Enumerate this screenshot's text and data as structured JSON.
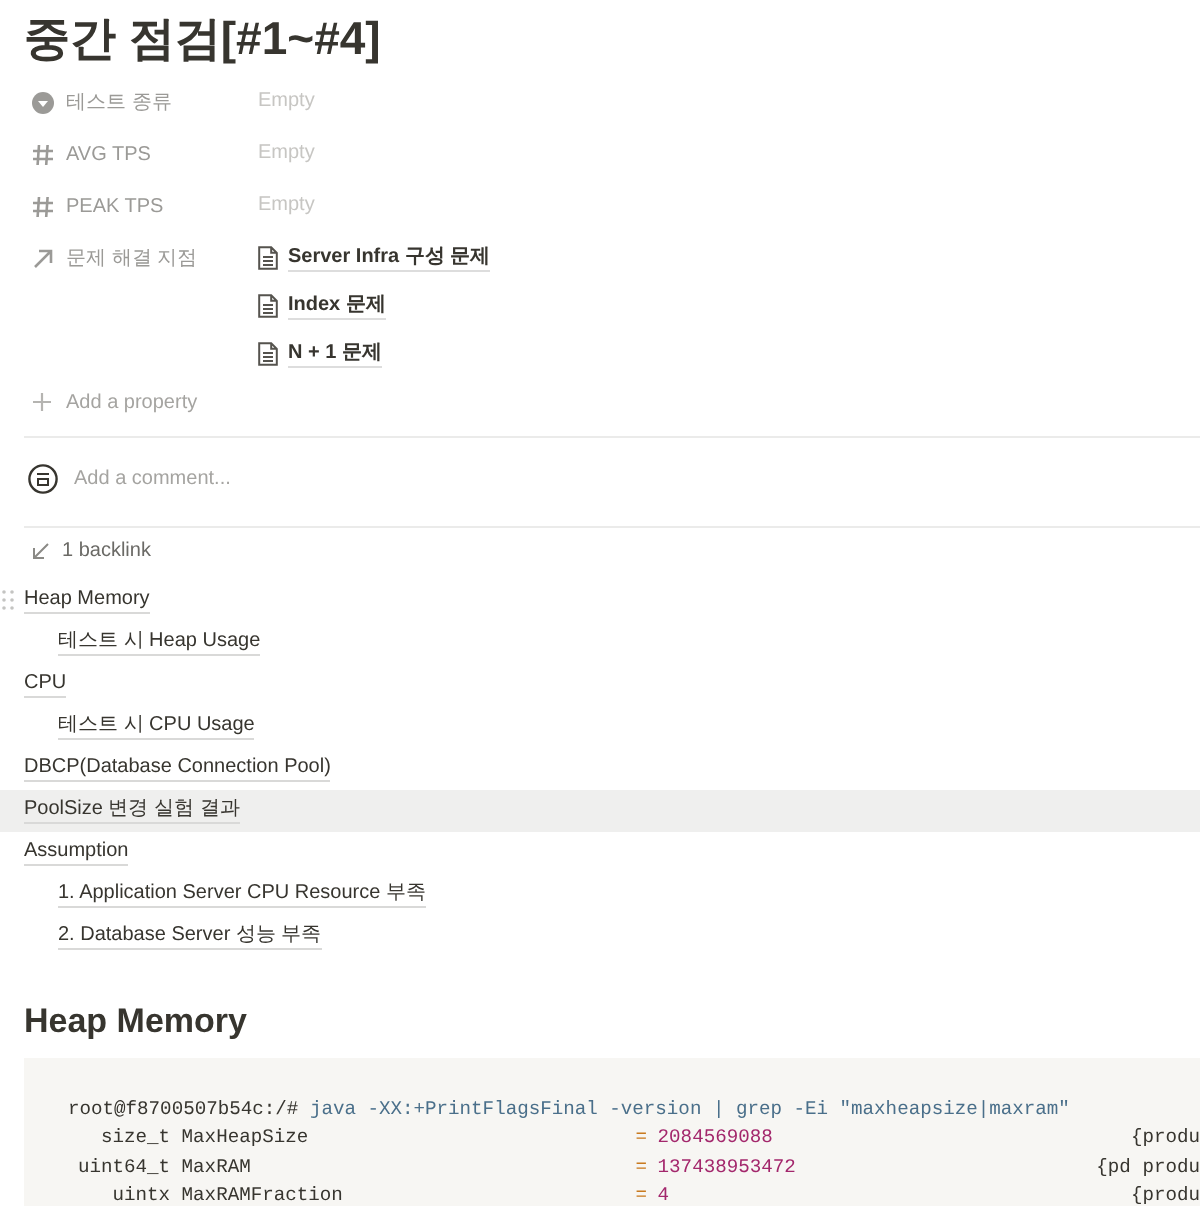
{
  "title": "중간 점검[#1~#4]",
  "properties": [
    {
      "kind": "select",
      "label": "테스트 종류",
      "value": "Empty"
    },
    {
      "kind": "number",
      "label": "AVG TPS",
      "value": "Empty"
    },
    {
      "kind": "number",
      "label": "PEAK TPS",
      "value": "Empty"
    },
    {
      "kind": "relation",
      "label": "문제 해결 지점",
      "pages": [
        "Server Infra 구성 문제",
        "Index 문제",
        "N + 1 문제"
      ]
    }
  ],
  "add_property": "Add a property",
  "comment": {
    "placeholder": "Add a comment..."
  },
  "backlinks": "1 backlink",
  "table_of_contents": [
    {
      "text": "Heap Memory",
      "selected": false,
      "handle": true,
      "children": [
        {
          "text": "테스트 시 Heap Usage",
          "selected": false,
          "handle": false
        }
      ]
    },
    {
      "text": "CPU",
      "selected": false,
      "handle": false,
      "children": [
        {
          "text": "테스트 시 CPU Usage",
          "selected": false,
          "handle": false
        }
      ]
    },
    {
      "text": "DBCP(Database Connection Pool)",
      "selected": false,
      "handle": false
    },
    {
      "text": "PoolSize 변경 실험 결과",
      "selected": true,
      "handle": false
    },
    {
      "text": "Assumption",
      "selected": false,
      "handle": false,
      "children": [
        {
          "text": "1. Application Server CPU Resource 부족",
          "selected": false,
          "handle": false
        },
        {
          "text": "2. Database Server 성능 부족",
          "selected": false,
          "handle": false
        }
      ]
    }
  ],
  "heading": "Heap Memory",
  "code": {
    "command": [
      {
        "kind": "plain",
        "text": "root@f8700507b54c:/#"
      },
      {
        "kind": "keyword",
        "text": "java -XX:+PrintFlagsFinal -version | grep -Ei \"maxheapsize|maxram\""
      }
    ],
    "flags": [
      {
        "type": "size_t",
        "name": "MaxHeapSize",
        "op": "=",
        "value": "2084569088",
        "origin": "{produ"
      },
      {
        "type": "uint64_t",
        "name": "MaxRAM",
        "op": "=",
        "value": "137438953472",
        "origin": "{pd produ"
      },
      {
        "type": "uintx",
        "name": "MaxRAMFraction",
        "op": "=",
        "value": "4",
        "origin": "{produ"
      }
    ]
  }
}
